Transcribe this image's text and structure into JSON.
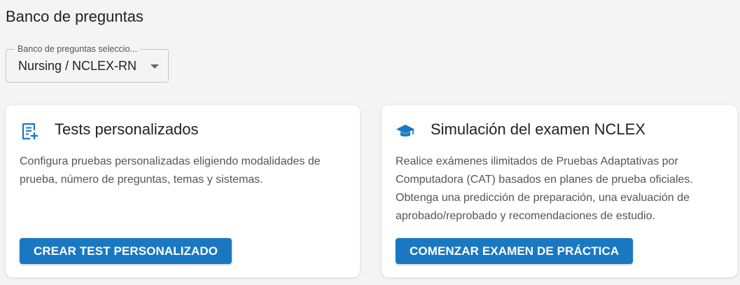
{
  "page": {
    "title": "Banco de preguntas"
  },
  "qbank_select": {
    "label": "Banco de preguntas seleccio...",
    "value": "Nursing / NCLEX-RN"
  },
  "cards": {
    "custom_tests": {
      "icon": "note-add-icon",
      "title": "Tests personalizados",
      "description": "Configura pruebas personalizadas eligiendo modalidades de prueba, número de preguntas, temas y sistemas.",
      "button_label": "CREAR TEST PERSONALIZADO"
    },
    "nclex_simulation": {
      "icon": "graduation-cap-icon",
      "title": "Simulación del examen NCLEX",
      "description": "Realice exámenes ilimitados de Pruebas Adaptativas por Computadora (CAT) basados en planes de prueba oficiales. Obtenga una predicción de preparación, una evaluación de aprobado/reprobado y recomendaciones de estudio.",
      "button_label": "COMENZAR EXAMEN DE PRÁCTICA"
    }
  },
  "colors": {
    "background": "#f4f4f4",
    "accent": "#1a78c2",
    "card": "#ffffff"
  }
}
